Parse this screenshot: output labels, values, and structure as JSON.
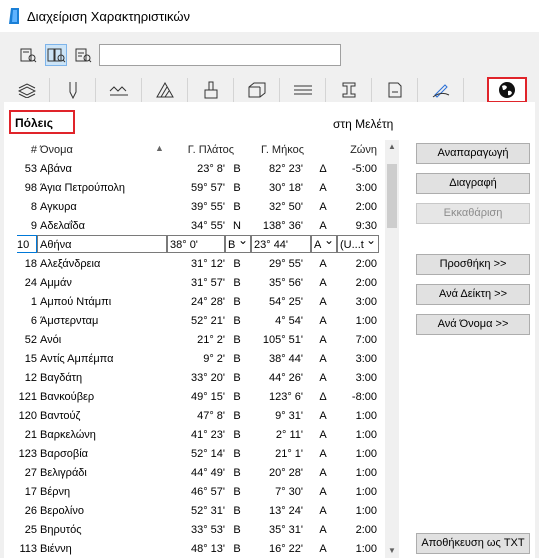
{
  "window": {
    "title": "Διαχείριση Χαρακτηριστικών"
  },
  "toolbar": {
    "search_value": ""
  },
  "tabs": [
    "layers",
    "pens",
    "lines",
    "fills",
    "surfaces",
    "materials",
    "composites",
    "profiles",
    "zones",
    "markups",
    "cities"
  ],
  "section": {
    "title": "Πόλεις",
    "project_label": "στη Μελέτη"
  },
  "columns": {
    "num": "#",
    "name": "Όνομα",
    "lat": "Γ. Πλάτος",
    "lon": "Γ. Μήκος",
    "zone": "Ζώνη"
  },
  "rows": [
    {
      "num": "53",
      "name": "Αβάνα",
      "lat": "23° 8'",
      "ns": "B",
      "lon": "82° 23'",
      "ew": "Δ",
      "zone": "-5:00"
    },
    {
      "num": "98",
      "name": "Άγια Πετρούπολη",
      "lat": "59° 57'",
      "ns": "B",
      "lon": "30° 18'",
      "ew": "A",
      "zone": "3:00"
    },
    {
      "num": "8",
      "name": "Αγκυρα",
      "lat": "39° 55'",
      "ns": "B",
      "lon": "32° 50'",
      "ew": "A",
      "zone": "2:00"
    },
    {
      "num": "9",
      "name": "Αδελαΐδα",
      "lat": "34° 55'",
      "ns": "N",
      "lon": "138° 36'",
      "ew": "A",
      "zone": "9:30"
    },
    {
      "num": "10",
      "name": "Αθήνα",
      "lat": "38° 0'",
      "ns": "B",
      "lon": "23° 44'",
      "ew": "A",
      "zone": "(U...t"
    },
    {
      "num": "18",
      "name": "Αλεξάνδρεια",
      "lat": "31° 12'",
      "ns": "B",
      "lon": "29° 55'",
      "ew": "A",
      "zone": "2:00"
    },
    {
      "num": "24",
      "name": "Αμμάν",
      "lat": "31° 57'",
      "ns": "B",
      "lon": "35° 56'",
      "ew": "A",
      "zone": "2:00"
    },
    {
      "num": "1",
      "name": "Αμπού Ντάμπι",
      "lat": "24° 28'",
      "ns": "B",
      "lon": "54° 25'",
      "ew": "A",
      "zone": "3:00"
    },
    {
      "num": "6",
      "name": "Άμστερνταμ",
      "lat": "52° 21'",
      "ns": "B",
      "lon": "4° 54'",
      "ew": "A",
      "zone": "1:00"
    },
    {
      "num": "52",
      "name": "Ανόι",
      "lat": "21° 2'",
      "ns": "B",
      "lon": "105° 51'",
      "ew": "A",
      "zone": "7:00"
    },
    {
      "num": "15",
      "name": "Αντίς Αμπέμπα",
      "lat": "9° 2'",
      "ns": "B",
      "lon": "38° 44'",
      "ew": "A",
      "zone": "3:00"
    },
    {
      "num": "12",
      "name": "Βαγδάτη",
      "lat": "33° 20'",
      "ns": "B",
      "lon": "44° 26'",
      "ew": "A",
      "zone": "3:00"
    },
    {
      "num": "121",
      "name": "Βανκούβερ",
      "lat": "49° 15'",
      "ns": "B",
      "lon": "123° 6'",
      "ew": "Δ",
      "zone": "-8:00"
    },
    {
      "num": "120",
      "name": "Βαντούζ",
      "lat": "47° 8'",
      "ns": "B",
      "lon": "9° 31'",
      "ew": "A",
      "zone": "1:00"
    },
    {
      "num": "21",
      "name": "Βαρκελώνη",
      "lat": "41° 23'",
      "ns": "B",
      "lon": "2° 11'",
      "ew": "A",
      "zone": "1:00"
    },
    {
      "num": "123",
      "name": "Βαρσοβία",
      "lat": "52° 14'",
      "ns": "B",
      "lon": "21° 1'",
      "ew": "A",
      "zone": "1:00"
    },
    {
      "num": "27",
      "name": "Βελιγράδι",
      "lat": "44° 49'",
      "ns": "B",
      "lon": "20° 28'",
      "ew": "A",
      "zone": "1:00"
    },
    {
      "num": "17",
      "name": "Βέρνη",
      "lat": "46° 57'",
      "ns": "B",
      "lon": "7° 30'",
      "ew": "A",
      "zone": "1:00"
    },
    {
      "num": "26",
      "name": "Βερολίνο",
      "lat": "52° 31'",
      "ns": "B",
      "lon": "13° 24'",
      "ew": "A",
      "zone": "1:00"
    },
    {
      "num": "25",
      "name": "Βηρυτός",
      "lat": "33° 53'",
      "ns": "B",
      "lon": "35° 31'",
      "ew": "A",
      "zone": "2:00"
    },
    {
      "num": "113",
      "name": "Βιέννη",
      "lat": "48° 13'",
      "ns": "B",
      "lon": "16° 22'",
      "ew": "A",
      "zone": "1:00"
    }
  ],
  "buttons": {
    "duplicate": "Αναπαραγωγή",
    "delete": "Διαγραφή",
    "clear": "Εκκαθάριση",
    "add": "Προσθήκη >>",
    "by_index": "Ανά Δείκτη >>",
    "by_name": "Ανά Όνομα >>",
    "save_txt": "Αποθήκευση ως TXT"
  },
  "colors": {
    "highlight": "#e0242a",
    "focus": "#0078d7"
  }
}
